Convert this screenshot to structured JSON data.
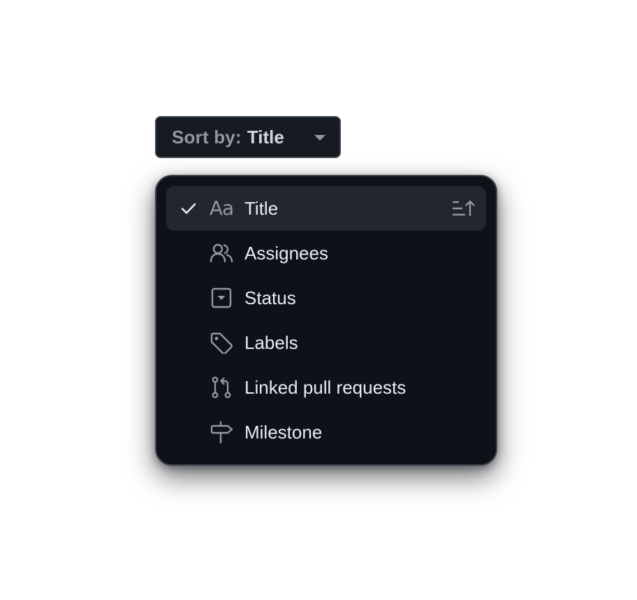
{
  "sort_button": {
    "prefix": "Sort by:",
    "value": "Title",
    "caret_icon": "triangle-down-icon"
  },
  "menu": {
    "items": [
      {
        "label": "Title",
        "icon": "typography-icon",
        "icon_text": "Aa",
        "selected": true,
        "direction_icon": "sort-ascending-icon"
      },
      {
        "label": "Assignees",
        "icon": "people-icon",
        "selected": false
      },
      {
        "label": "Status",
        "icon": "single-select-icon",
        "selected": false
      },
      {
        "label": "Labels",
        "icon": "tag-icon",
        "selected": false
      },
      {
        "label": "Linked pull requests",
        "icon": "git-pull-request-icon",
        "selected": false
      },
      {
        "label": "Milestone",
        "icon": "milestone-icon",
        "selected": false
      }
    ]
  },
  "colors": {
    "background": "#ffffff",
    "surface": "#0e1218",
    "button_surface": "#161b22",
    "border": "#3d444d",
    "active_row": "#212630",
    "text_primary": "#e6edf3",
    "text_muted": "#9198a1"
  }
}
